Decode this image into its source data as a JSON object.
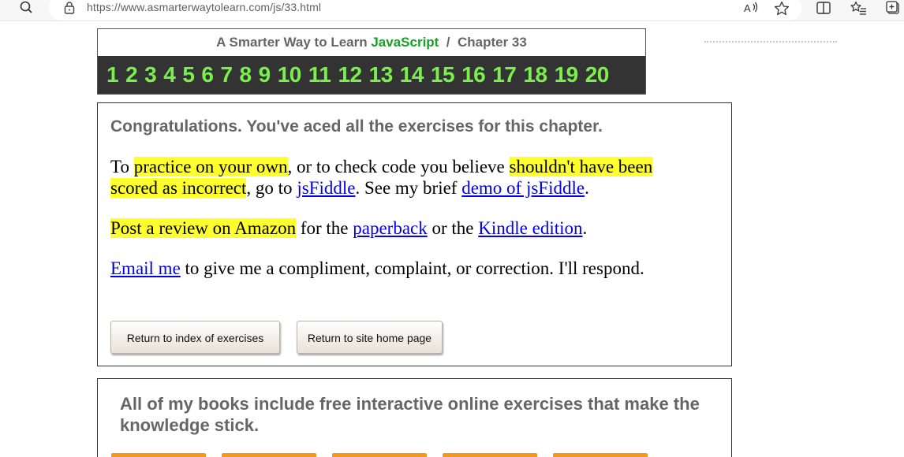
{
  "browser": {
    "url": "https://www.asmarterwaytolearn.com/js/33.html",
    "icons": [
      "search-icon",
      "lock-icon",
      "read-aloud-icon",
      "favorite-star-icon",
      "split-screen-icon",
      "favorites-list-icon",
      "collections-icon"
    ]
  },
  "header": {
    "title_prefix": "A Smarter Way to Learn ",
    "title_brand": "JavaScript",
    "title_suffix": "  /  Chapter 33",
    "chapters": [
      "1",
      "2",
      "3",
      "4",
      "5",
      "6",
      "7",
      "8",
      "9",
      "10",
      "11",
      "12",
      "13",
      "14",
      "15",
      "16",
      "17",
      "18",
      "19",
      "20"
    ],
    "nav_color": "#7bf04d"
  },
  "congrats": {
    "title": "Congratulations. You've aced all the exercises for this chapter.",
    "p1_a": "To ",
    "p1_hl1": "practice on your own",
    "p1_b": ", or to check code you believe ",
    "p1_hl2": "shouldn't have been scored as incorrect",
    "p1_c": ", go to ",
    "p1_link1": "jsFiddle",
    "p1_d": ". See my brief ",
    "p1_link2": "demo of jsFiddle",
    "p1_e": ".",
    "p2_hl": "Post a review on Amazon",
    "p2_a": " for the ",
    "p2_link1": "paperback",
    "p2_b": " or the ",
    "p2_link2": "Kindle edition",
    "p2_c": ".",
    "p3_link": "Email me",
    "p3_a": " to give me a compliment, complaint, or correction. I'll respond.",
    "btn_index": "Return to index of exercises",
    "btn_home": "Return to site home page"
  },
  "books": {
    "title": "All of my books include free interactive online exercises that make the knowledge stick."
  },
  "colors": {
    "highlight": "#ffff2e",
    "link": "#0000ee",
    "brand_green": "#1a9e28",
    "tab_orange": "#f39a1e"
  }
}
